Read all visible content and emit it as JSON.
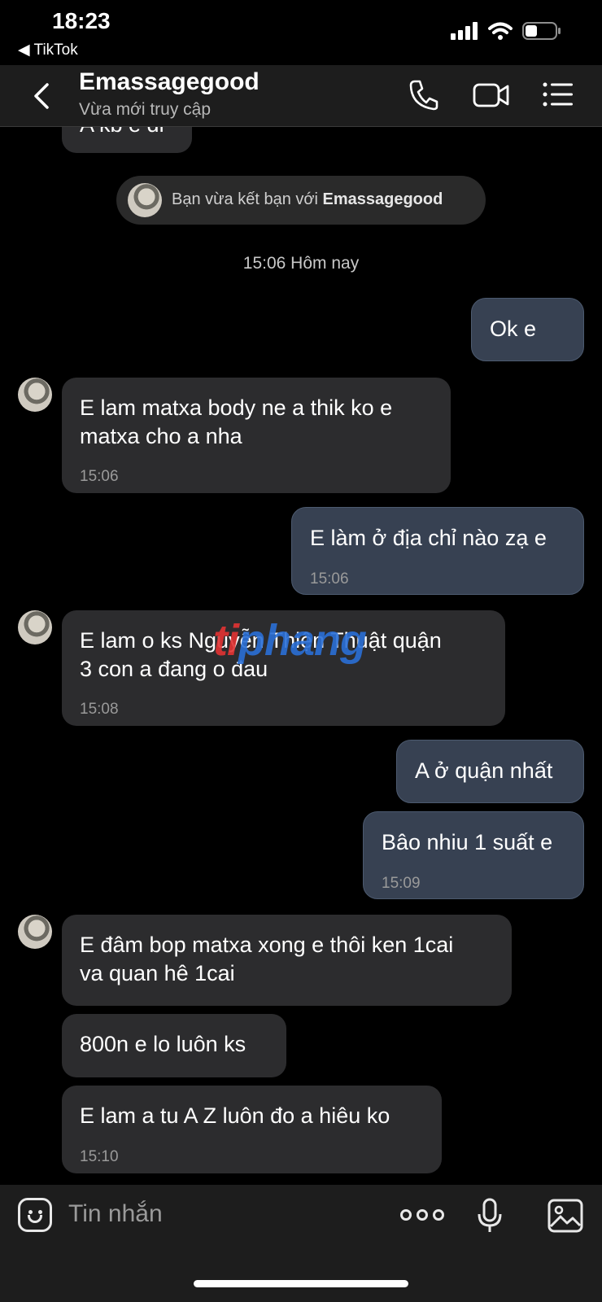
{
  "status_bar": {
    "time": "18:23",
    "back_app": "◀ TikTok"
  },
  "header": {
    "title": "Emassagegood",
    "subtitle": "Vừa mới truy cập"
  },
  "chat": {
    "partial_message": "A kb e di",
    "friend_notice": {
      "prefix": "Bạn vừa kết bạn với ",
      "name": "Emassagegood"
    },
    "day_stamp": "15:06 Hôm nay",
    "messages": [
      {
        "dir": "out",
        "text": "Ok e",
        "time": ""
      },
      {
        "dir": "in",
        "text": "E lam matxa body ne a thik ko e\nmatxa cho a nha",
        "time": "15:06"
      },
      {
        "dir": "out",
        "text": "E làm ở địa chỉ nào zạ e",
        "time": "15:06"
      },
      {
        "dir": "in",
        "text": "E lam o ks Nguyễn Thiện Thuật quận\n3 con a đang o đau",
        "time": "15:08"
      },
      {
        "dir": "out",
        "text": "A ở quận nhất",
        "time": ""
      },
      {
        "dir": "out",
        "text": "Bâo nhiu 1 suất e",
        "time": "15:09"
      },
      {
        "dir": "in",
        "text": "E đâm bop matxa xong e thôi ken 1cai\nva quan hê 1cai",
        "time": ""
      },
      {
        "dir": "in",
        "text": "800n e lo luôn ks",
        "time": ""
      },
      {
        "dir": "in",
        "text": "E lam a tu A Z luôn đo a hiêu ko",
        "time": "15:10"
      }
    ],
    "watermark": {
      "part1": "ti",
      "part2": "phang"
    }
  },
  "composer": {
    "placeholder": "Tin nhắn"
  },
  "colors": {
    "incoming_bubble": "#2c2c2e",
    "outgoing_bubble": "#374152",
    "background": "#000000"
  }
}
